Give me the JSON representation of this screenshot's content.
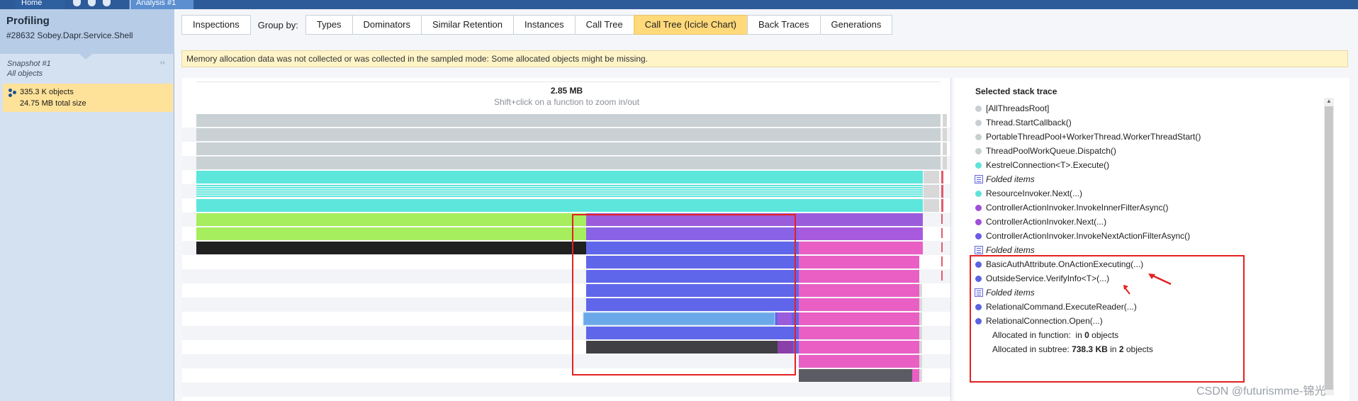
{
  "top_bar": {
    "home_label": "Home",
    "analysis_label": "Analysis #1"
  },
  "left_panel": {
    "title": "Profiling",
    "process": "#28632 Sobey.Dapr.Service.Shell",
    "snapshot": "Snapshot #1",
    "scope": "All objects",
    "objects_value": "335.3 K",
    "objects_unit": "objects",
    "size_value": "24.75 MB",
    "size_unit": "total size"
  },
  "tabs": {
    "inspections": "Inspections",
    "group_by": "Group by:",
    "items": [
      "Types",
      "Dominators",
      "Similar Retention",
      "Instances",
      "Call Tree",
      "Call Tree (Icicle Chart)",
      "Back Traces",
      "Generations"
    ],
    "active": "Call Tree (Icicle Chart)"
  },
  "warning": "Memory allocation data was not collected or was collected in the sampled mode: Some allocated objects might be missing.",
  "flame": {
    "size_label": "2.85 MB",
    "hint": "Shift+click on a function to zoom in/out"
  },
  "stack": {
    "title": "Selected stack trace",
    "items": [
      {
        "label": "[AllThreadsRoot]",
        "color": "#c7cfd1",
        "kind": "dot"
      },
      {
        "label": "Thread.StartCallback()",
        "color": "#c7cfd1",
        "kind": "dot"
      },
      {
        "label": "PortableThreadPool+WorkerThread.WorkerThreadStart()",
        "color": "#c7cfd1",
        "kind": "dot"
      },
      {
        "label": "ThreadPoolWorkQueue.Dispatch()",
        "color": "#c7cfd1",
        "kind": "dot"
      },
      {
        "label": "KestrelConnection<T>.Execute()",
        "color": "#5ee3da",
        "kind": "dot"
      },
      {
        "label": "Folded items",
        "color": "#5ee3da",
        "kind": "fold"
      },
      {
        "label": "ResourceInvoker.Next(...)",
        "color": "#5ee3da",
        "kind": "dot"
      },
      {
        "label": "ControllerActionInvoker.InvokeInnerFilterAsync()",
        "color": "#a04fd8",
        "kind": "dot"
      },
      {
        "label": "ControllerActionInvoker.Next(...)",
        "color": "#a04fd8",
        "kind": "dot"
      },
      {
        "label": "ControllerActionInvoker.InvokeNextActionFilterAsync()",
        "color": "#6a5be8",
        "kind": "dot"
      },
      {
        "label": "Folded items",
        "color": "#6a5be8",
        "kind": "fold"
      },
      {
        "label": "BasicAuthAttribute.OnActionExecuting(...)",
        "color": "#5a63e0",
        "kind": "dot"
      },
      {
        "label": "OutsideService.VerifyInfo<T>(...)",
        "color": "#5a63e0",
        "kind": "dot"
      },
      {
        "label": "Folded items",
        "color": "#5a63e0",
        "kind": "fold"
      },
      {
        "label": "RelationalCommand.ExecuteReader(...)",
        "color": "#5a63e0",
        "kind": "dot"
      },
      {
        "label": "RelationalConnection.Open(...)",
        "color": "#5a63e0",
        "kind": "dot"
      }
    ],
    "alloc_function_label": "Allocated in function:",
    "alloc_function_prefix": "in",
    "alloc_function_count": "0",
    "alloc_function_unit": "objects",
    "alloc_subtree_label": "Allocated in subtree:",
    "alloc_subtree_size": "738.3 KB",
    "alloc_subtree_in": "in",
    "alloc_subtree_count": "2",
    "alloc_subtree_unit": "objects"
  },
  "watermark": "CSDN @futurismme-锦光"
}
